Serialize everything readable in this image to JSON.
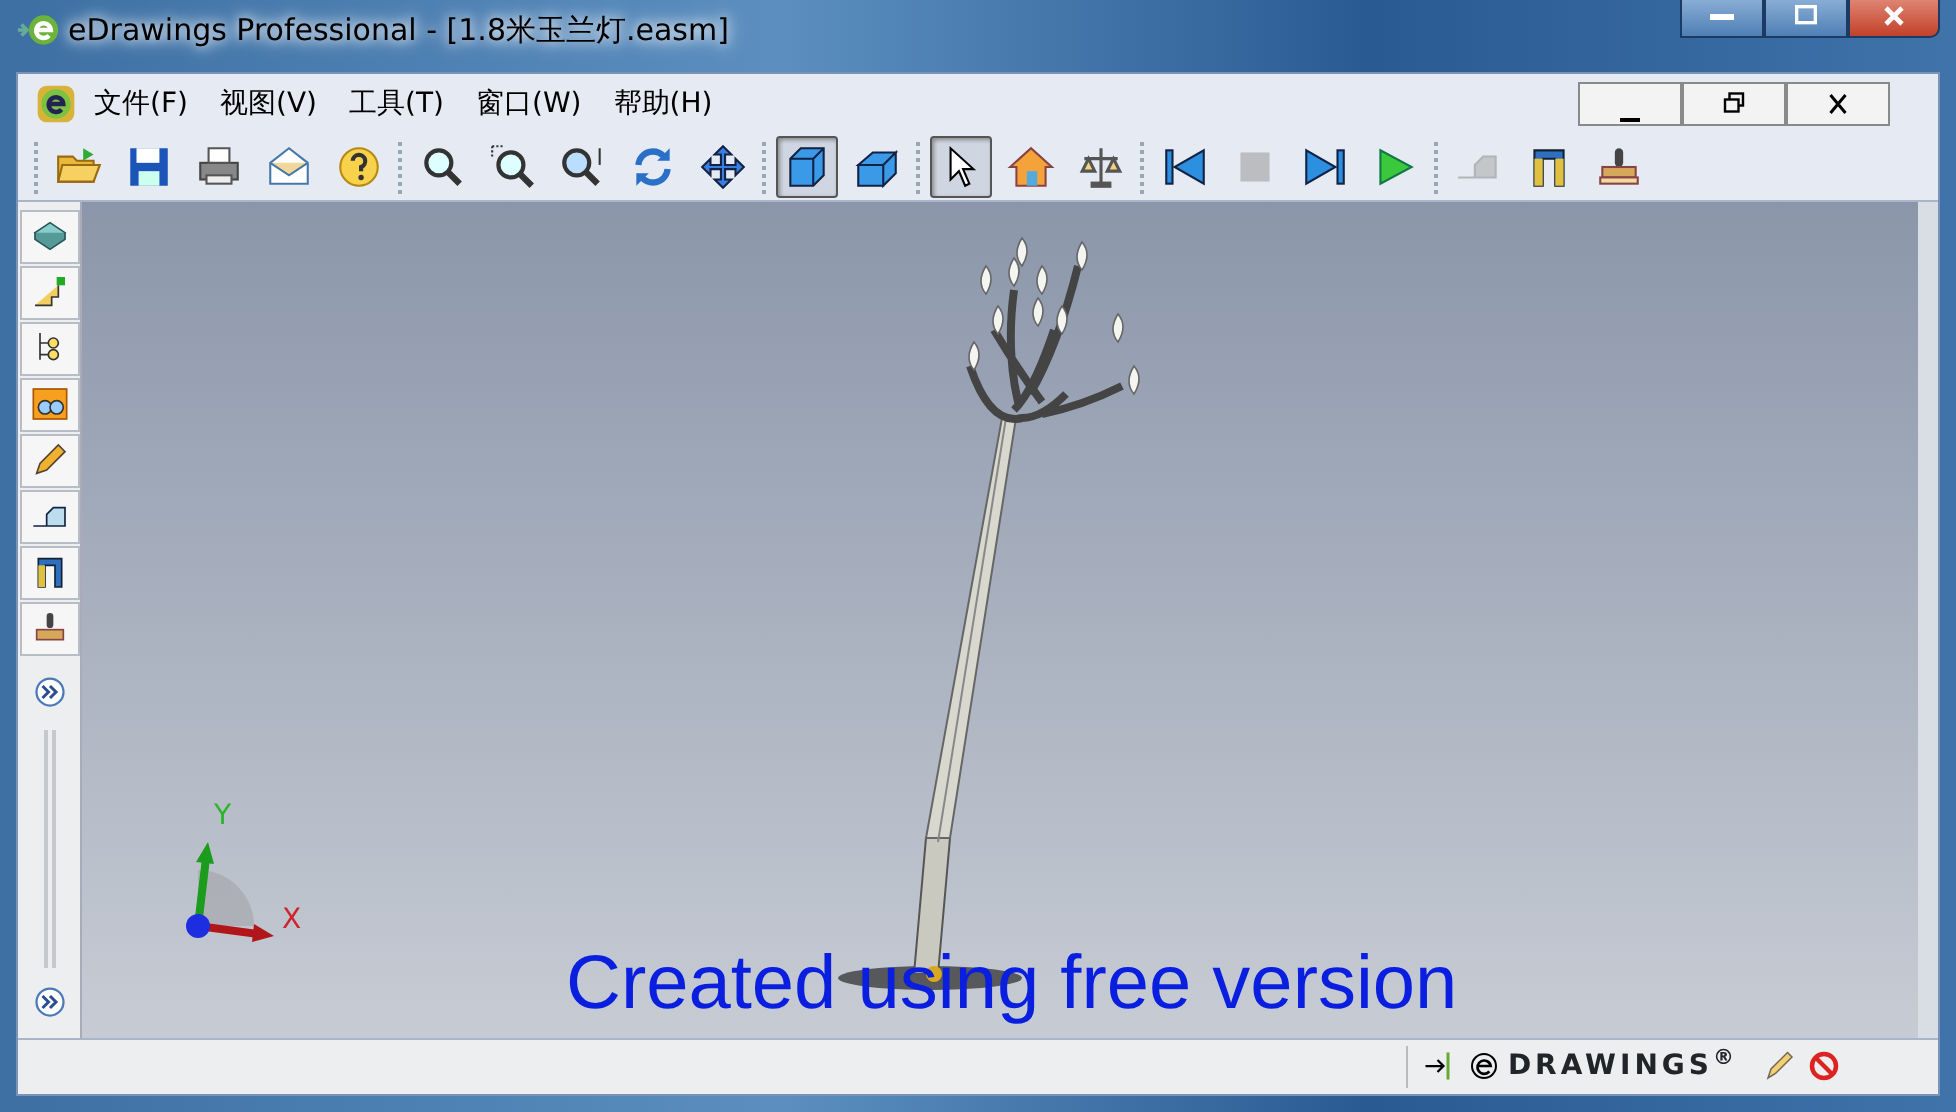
{
  "window": {
    "title": "eDrawings Professional - [1.8米玉兰灯.easm]"
  },
  "menu": [
    {
      "label": "文件(F)"
    },
    {
      "label": "视图(V)"
    },
    {
      "label": "工具(T)"
    },
    {
      "label": "窗口(W)"
    },
    {
      "label": "帮助(H)"
    }
  ],
  "toolbar_groups": [
    [
      {
        "selected": false,
        "disabled": false
      },
      {
        "selected": false,
        "disabled": false
      },
      {
        "selected": false,
        "disabled": false
      },
      {
        "selected": false,
        "disabled": false
      },
      {
        "selected": false,
        "disabled": false
      }
    ],
    [
      {
        "selected": false,
        "disabled": false
      },
      {
        "selected": false,
        "disabled": false
      },
      {
        "selected": false,
        "disabled": false
      },
      {
        "selected": false,
        "disabled": false
      },
      {
        "selected": false,
        "disabled": false
      }
    ],
    [
      {
        "selected": true,
        "disabled": false
      },
      {
        "selected": false,
        "disabled": false
      }
    ],
    [
      {
        "selected": true,
        "disabled": false
      },
      {
        "selected": false,
        "disabled": false
      },
      {
        "selected": false,
        "disabled": false
      }
    ],
    [
      {
        "selected": false,
        "disabled": false
      },
      {
        "selected": false,
        "disabled": true
      },
      {
        "selected": false,
        "disabled": false
      },
      {
        "selected": false,
        "disabled": false
      }
    ],
    [
      {
        "selected": false,
        "disabled": true
      },
      {
        "selected": false,
        "disabled": false
      },
      {
        "selected": false,
        "disabled": false
      }
    ]
  ],
  "viewport": {
    "axis_x": "X",
    "axis_y": "Y",
    "overlay_text": "Created using free version"
  },
  "status_bar": {
    "brand": "DRAWINGS$^{®}$"
  }
}
